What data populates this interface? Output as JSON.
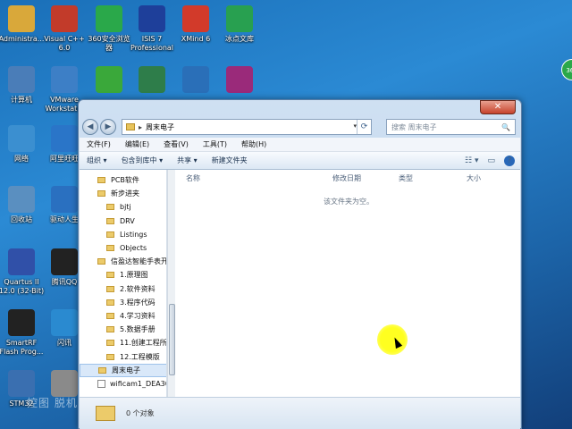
{
  "desktop_icons": [
    {
      "label": "Administra...",
      "icon": "user-folder-icon",
      "color": "#d9a83a"
    },
    {
      "label": "Visual C++\n6.0",
      "icon": "visual-cpp-icon",
      "color": "#c23b2a"
    },
    {
      "label": "360安全浏览\n器",
      "icon": "browser-360-icon",
      "color": "#2aa84a"
    },
    {
      "label": "ISIS 7\nProfessional",
      "icon": "isis-icon",
      "color": "#1e3f9a"
    },
    {
      "label": "XMind 6",
      "icon": "xmind-icon",
      "color": "#d23a2a"
    },
    {
      "label": "冰点文库",
      "icon": "bingdian-icon",
      "color": "#28a050"
    },
    {
      "label": "计算机",
      "icon": "computer-icon",
      "color": "#4a7db8"
    },
    {
      "label": "VMware\nWorkstatio",
      "icon": "vmware-icon",
      "color": "#3d7fc6"
    },
    {
      "label": "",
      "icon": "wifi-icon",
      "color": "#3aa83a"
    },
    {
      "label": "",
      "icon": "vs-icon",
      "color": "#2e7d4a"
    },
    {
      "label": "",
      "icon": "network-share-icon",
      "color": "#2a6fb8"
    },
    {
      "label": "",
      "icon": "signal-icon",
      "color": "#9a2a7a"
    },
    {
      "label": "网络",
      "icon": "network-icon",
      "color": "#3b8fd0"
    },
    {
      "label": "阿里旺旺",
      "icon": "aliwangwang-icon",
      "color": "#2a75c8"
    },
    {
      "label": "回收站",
      "icon": "recycle-bin-icon",
      "color": "#5a8fc0"
    },
    {
      "label": "驱动人生",
      "icon": "driver-icon",
      "color": "#2a70c0"
    },
    {
      "label": "Quartus II\n12.0 (32-Bit)",
      "icon": "quartus-icon",
      "color": "#3050a8"
    },
    {
      "label": "腾讯QQ",
      "icon": "qq-icon",
      "color": "#222222"
    },
    {
      "label": "SmartRF\nFlash Prog...",
      "icon": "smartrf-icon",
      "color": "#222222"
    },
    {
      "label": "闪讯",
      "icon": "shanxun-icon",
      "color": "#2a8ad0"
    },
    {
      "label": "STM32",
      "icon": "stm32-icon",
      "color": "#3a6fb0"
    },
    {
      "label": "",
      "icon": "grid-app-icon",
      "color": "#8a8a8a"
    }
  ],
  "window": {
    "close_label": "✕",
    "nav": {
      "back_label": "◀",
      "forward_label": "▶",
      "path_sep": "▸",
      "path": "周末电子",
      "dropdown": "▾",
      "refresh": "⟳"
    },
    "search": {
      "placeholder": "搜索 周末电子",
      "icon": "🔍"
    },
    "menu": [
      "文件(F)",
      "编辑(E)",
      "查看(V)",
      "工具(T)",
      "帮助(H)"
    ],
    "toolbar": {
      "organize": "组织 ▾",
      "include": "包含到库中 ▾",
      "share": "共享 ▾",
      "new_folder": "新建文件夹",
      "view_icon": "☷ ▾",
      "pane_icon": "▭",
      "help_icon": "?"
    },
    "tree": [
      {
        "label": "PCB软件",
        "indent": 1,
        "type": "folder"
      },
      {
        "label": "新步进夹",
        "indent": 1,
        "type": "folder"
      },
      {
        "label": "bjtj",
        "indent": 2,
        "type": "folder"
      },
      {
        "label": "DRV",
        "indent": 2,
        "type": "folder"
      },
      {
        "label": "Listings",
        "indent": 2,
        "type": "folder"
      },
      {
        "label": "Objects",
        "indent": 2,
        "type": "folder"
      },
      {
        "label": "信盈达智能手表开发",
        "indent": 1,
        "type": "folder"
      },
      {
        "label": "1.原理图",
        "indent": 2,
        "type": "folder"
      },
      {
        "label": "2.软件资料",
        "indent": 2,
        "type": "folder"
      },
      {
        "label": "3.程序代码",
        "indent": 2,
        "type": "folder"
      },
      {
        "label": "4.学习资料",
        "indent": 2,
        "type": "folder"
      },
      {
        "label": "5.数据手册",
        "indent": 2,
        "type": "folder"
      },
      {
        "label": "11.创建工程所需",
        "indent": 2,
        "type": "folder"
      },
      {
        "label": "12.工程模版",
        "indent": 2,
        "type": "folder"
      },
      {
        "label": "周末电子",
        "indent": 1,
        "type": "folder",
        "selected": true
      },
      {
        "label": "wificam1_DEA30_",
        "indent": 1,
        "type": "file"
      }
    ],
    "columns": [
      "名称",
      "修改日期",
      "类型",
      "大小"
    ],
    "empty_message": "该文件夹为空。",
    "status": "0 个对象"
  },
  "tray_badge": "360",
  "watermark": "控图 脱机"
}
